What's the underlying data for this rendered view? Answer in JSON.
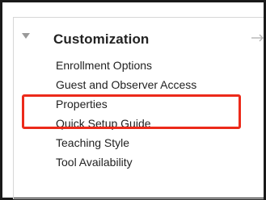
{
  "menu": {
    "title": "Customization",
    "collapse_icon": "caret-down-icon",
    "open_icon": "arrow-right-icon",
    "items": [
      {
        "label": "Enrollment Options"
      },
      {
        "label": "Guest and Observer Access"
      },
      {
        "label": "Properties"
      },
      {
        "label": "Quick Setup Guide"
      },
      {
        "label": "Teaching Style"
      },
      {
        "label": "Tool Availability"
      }
    ]
  },
  "highlight": {
    "target": "Properties",
    "color": "#ec2a1a"
  }
}
